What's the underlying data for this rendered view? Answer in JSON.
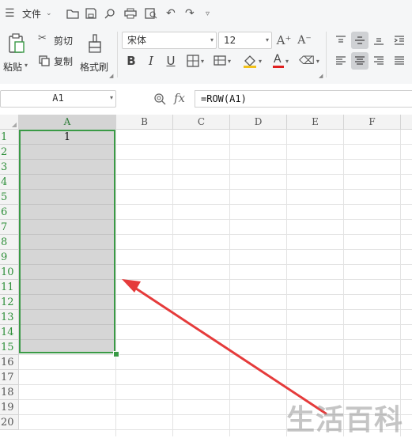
{
  "menubar": {
    "file_label": "文件",
    "icons": [
      "menu-icon",
      "open-folder-icon",
      "save-icon",
      "find-icon",
      "print-icon",
      "print-preview-icon",
      "undo-icon",
      "redo-icon",
      "customize-icon"
    ]
  },
  "ribbon": {
    "paste_label": "粘贴",
    "cut_label": "剪切",
    "copy_label": "复制",
    "format_painter_label": "格式刷",
    "font_name": "宋体",
    "font_size": "12",
    "bold": "B",
    "italic": "I",
    "underline": "U",
    "font_color_letter": "A",
    "grow_font": "A⁺",
    "shrink_font": "A⁻"
  },
  "formula_bar": {
    "name_box": "A1",
    "fx_label": "fx",
    "formula": "=ROW(A1)"
  },
  "grid": {
    "columns": [
      "A",
      "B",
      "C",
      "D",
      "E",
      "F"
    ],
    "rows": [
      "1",
      "2",
      "3",
      "4",
      "5",
      "6",
      "7",
      "8",
      "9",
      "10",
      "11",
      "12",
      "13",
      "14",
      "15",
      "16",
      "17",
      "18",
      "19",
      "20"
    ],
    "selected_column": "A",
    "selected_rows_range": "1-15",
    "cell_A1_value": "1"
  },
  "annotation": {
    "arrow_color": "#e53b3b",
    "watermark_text": "生活百科"
  },
  "colors": {
    "selection_border": "#3a9a46",
    "selection_fill": "#d6d6d6"
  }
}
